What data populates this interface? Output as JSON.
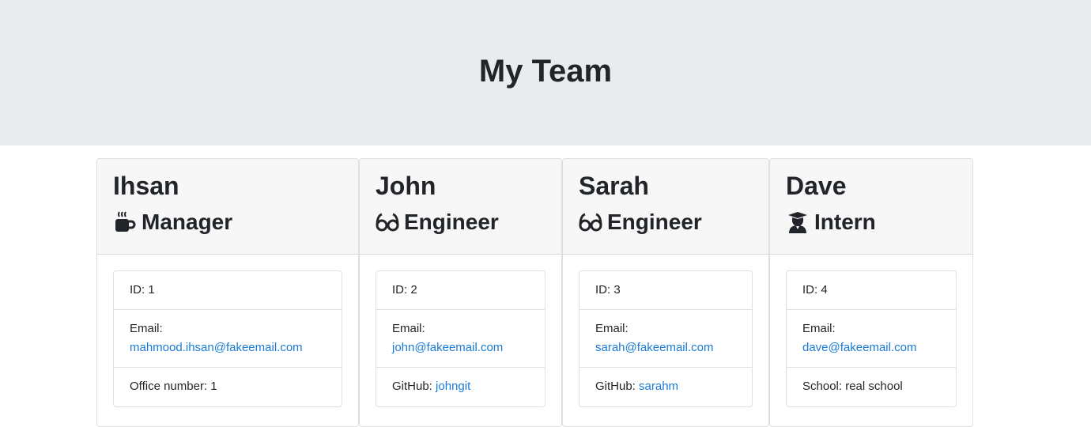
{
  "page": {
    "title": "My Team"
  },
  "team": [
    {
      "name": "Ihsan",
      "role": "Manager",
      "role_icon": "mug-hot-icon",
      "id_label": "ID: 1",
      "email_label": "Email:",
      "email": "mahmood.ihsan@fakeemail.com",
      "extra_label": "Office number: ",
      "extra_value": "1"
    },
    {
      "name": "John",
      "role": "Engineer",
      "role_icon": "glasses-icon",
      "id_label": "ID: 2",
      "email_label": "Email:",
      "email": "john@fakeemail.com",
      "extra_label": "GitHub: ",
      "extra_value": "johngit"
    },
    {
      "name": "Sarah",
      "role": "Engineer",
      "role_icon": "glasses-icon",
      "id_label": "ID: 3",
      "email_label": "Email:",
      "email": "sarah@fakeemail.com",
      "extra_label": "GitHub: ",
      "extra_value": "sarahm"
    },
    {
      "name": "Dave",
      "role": "Intern",
      "role_icon": "graduate-icon",
      "id_label": "ID: 4",
      "email_label": "Email:",
      "email": "dave@fakeemail.com",
      "extra_label": "School: ",
      "extra_value": "real school"
    }
  ],
  "colors": {
    "header_bg": "#e9ecef",
    "card_header_bg": "#f7f7f7",
    "link": "#1a7bd6"
  }
}
